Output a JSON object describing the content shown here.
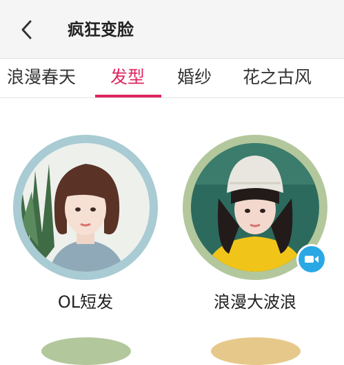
{
  "header": {
    "title": "疯狂变脸",
    "back_icon": "chevron-left-icon"
  },
  "tabs": [
    {
      "label": "浪漫春天",
      "active": false
    },
    {
      "label": "发型",
      "active": true
    },
    {
      "label": "婚纱",
      "active": false
    },
    {
      "label": "花之古风",
      "active": false
    }
  ],
  "styles": [
    {
      "label": "OL短发",
      "ring_color": "#a9cbd3",
      "has_video": false
    },
    {
      "label": "浪漫大波浪",
      "ring_color": "#b3c79c",
      "has_video": true,
      "video_icon": "video-camera-icon"
    }
  ],
  "colors": {
    "accent": "#e0245e",
    "video_badge": "#2aa8e6"
  }
}
